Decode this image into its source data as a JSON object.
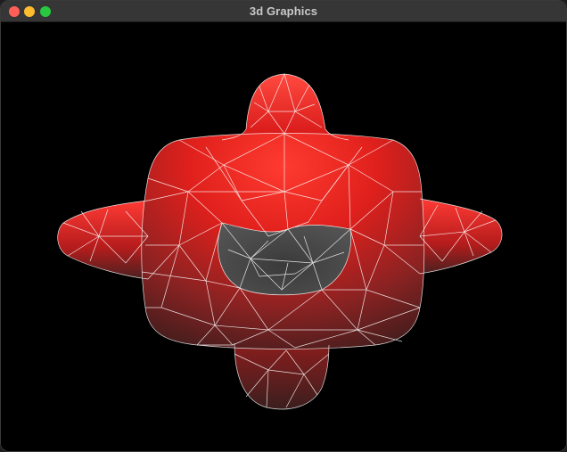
{
  "window": {
    "title": "3d Graphics",
    "controls": {
      "close_color": "#ff5f57",
      "minimize_color": "#febc2e",
      "zoom_color": "#28c840"
    }
  },
  "scene": {
    "background": "#000000",
    "mesh": {
      "render_mode": "wireframe-over-shaded",
      "fill_color_light": "#ff2a2a",
      "fill_color_dark": "#3a1c1c",
      "wire_color": "#ffffff"
    }
  }
}
